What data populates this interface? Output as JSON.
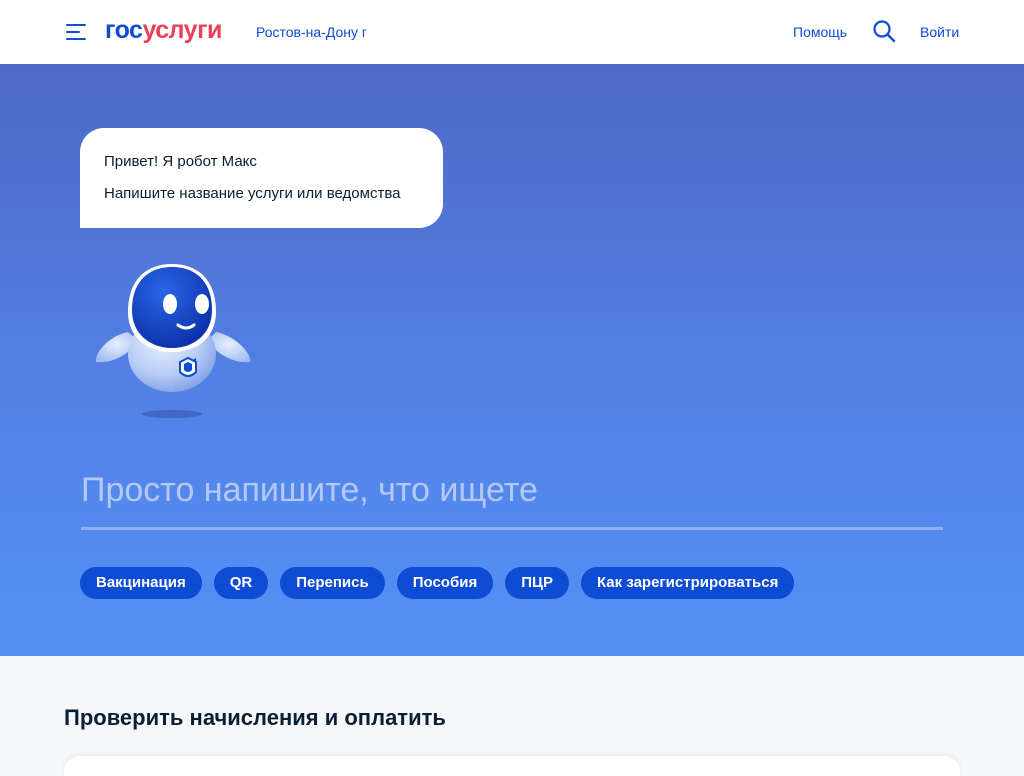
{
  "header": {
    "logo_part1": "гос",
    "logo_part2": "услуги",
    "city": "Ростов-на-Дону г",
    "help_label": "Помощь",
    "login_label": "Войти"
  },
  "hero": {
    "bubble_line1": "Привет! Я робот Макс",
    "bubble_line2": "Напишите название услуги или ведомства",
    "search_placeholder": "Просто напишите, что ищете",
    "chips": [
      "Вакцинация",
      "QR",
      "Перепись",
      "Пособия",
      "ПЦР",
      "Как зарегистрироваться"
    ]
  },
  "section": {
    "title": "Проверить начисления и оплатить"
  },
  "colors": {
    "brand_blue": "#0d4cd3",
    "brand_red": "#ee3f58",
    "hero_top": "#4e68c6",
    "hero_bottom": "#5491f5"
  },
  "icons": [
    "menu-icon",
    "search-icon",
    "robot-max-illustration"
  ]
}
